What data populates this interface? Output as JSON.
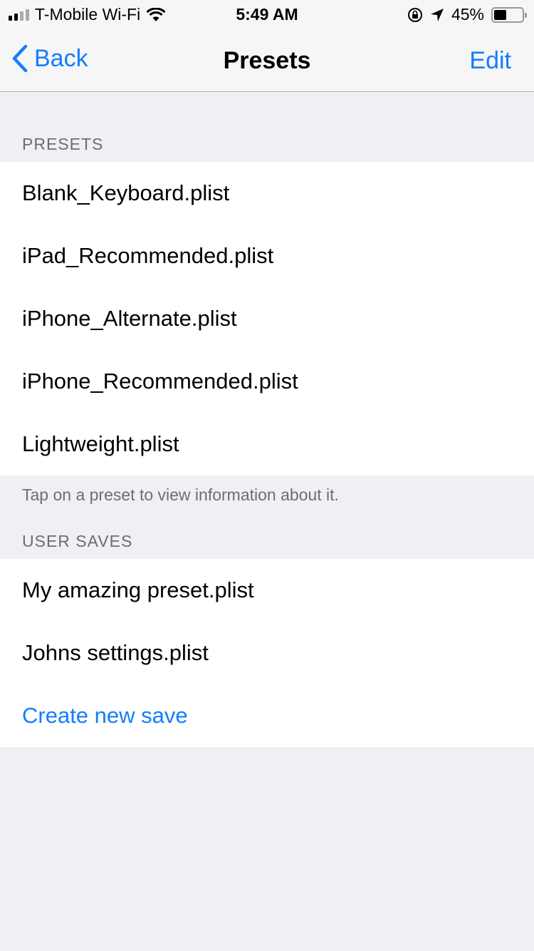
{
  "status": {
    "carrier": "T-Mobile Wi-Fi",
    "time": "5:49 AM",
    "battery": "45%",
    "battery_level": 0.45,
    "icons": [
      "signal-icon",
      "wifi-icon",
      "orientation-lock-icon",
      "location-icon",
      "battery-icon"
    ]
  },
  "nav": {
    "back": "Back",
    "title": "Presets",
    "edit": "Edit"
  },
  "presets": {
    "header": "PRESETS",
    "items": [
      "Blank_Keyboard.plist",
      "iPad_Recommended.plist",
      "iPhone_Alternate.plist",
      "iPhone_Recommended.plist",
      "Lightweight.plist"
    ],
    "footer": "Tap on a preset to view information about it."
  },
  "user_saves": {
    "header": "USER SAVES",
    "items": [
      "My amazing preset.plist",
      "Johns settings.plist"
    ],
    "create": "Create new save"
  },
  "colors": {
    "accent": "#147efb",
    "background": "#efeff4"
  }
}
